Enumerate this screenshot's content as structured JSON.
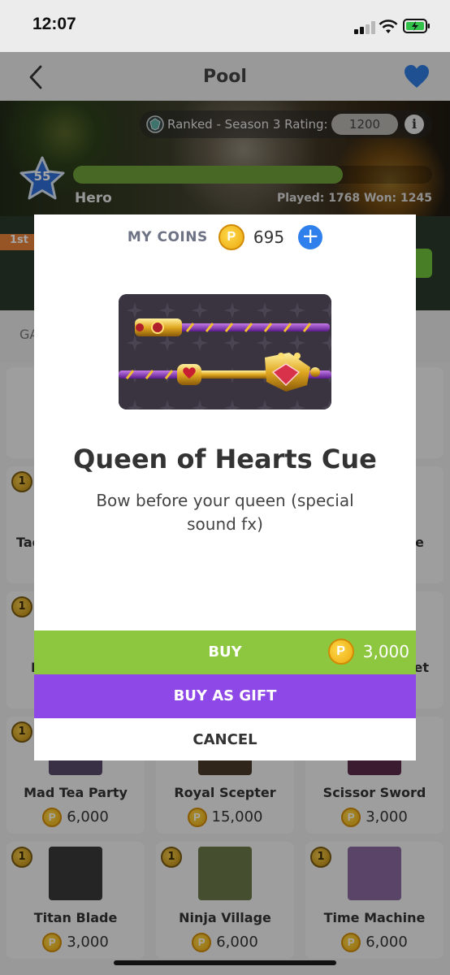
{
  "status_bar": {
    "time": "12:07"
  },
  "nav": {
    "title": "Pool"
  },
  "profile": {
    "ranked_label": "Ranked - Season 3 Rating:",
    "rating": "1200",
    "info_symbol": "i",
    "level": "55",
    "xp_progress": 0.75,
    "name": "Hero",
    "stats": "Played: 1768 Won: 1245"
  },
  "background": {
    "strip_badge": "1st",
    "tab_partial": "GA",
    "cards": [
      {
        "partial_name": "Tae",
        "count": "1"
      },
      {
        "partial_name": "e",
        "count": ""
      },
      {
        "partial_name": "F",
        "count": "1"
      },
      {
        "partial_name": "et",
        "count": ""
      },
      {
        "name": "Mad Tea Party",
        "price": "6,000",
        "count": "1"
      },
      {
        "name": "Royal Scepter",
        "price": "15,000",
        "count": ""
      },
      {
        "name": "Scissor Sword",
        "price": "3,000",
        "count": ""
      },
      {
        "name": "Titan Blade",
        "price": "3,000",
        "count": "1"
      },
      {
        "name": "Ninja Village",
        "price": "6,000",
        "count": "1"
      },
      {
        "name": "Time Machine",
        "price": "6,000",
        "count": "1"
      }
    ]
  },
  "modal": {
    "coins_label": "MY COINS",
    "coin_symbol": "P",
    "coins_value": "695",
    "add_symbol": "+",
    "item_title": "Queen of Hearts Cue",
    "item_description": "Bow before your queen (special sound fx)",
    "buy_label": "BUY",
    "buy_price": "3,000",
    "gift_label": "BUY AS GIFT",
    "cancel_label": "CANCEL"
  },
  "colors": {
    "buy_green": "#8dc63f",
    "gift_purple": "#8e48e8",
    "coin_gold": "#f5b820",
    "accent_blue": "#2f80ed"
  }
}
